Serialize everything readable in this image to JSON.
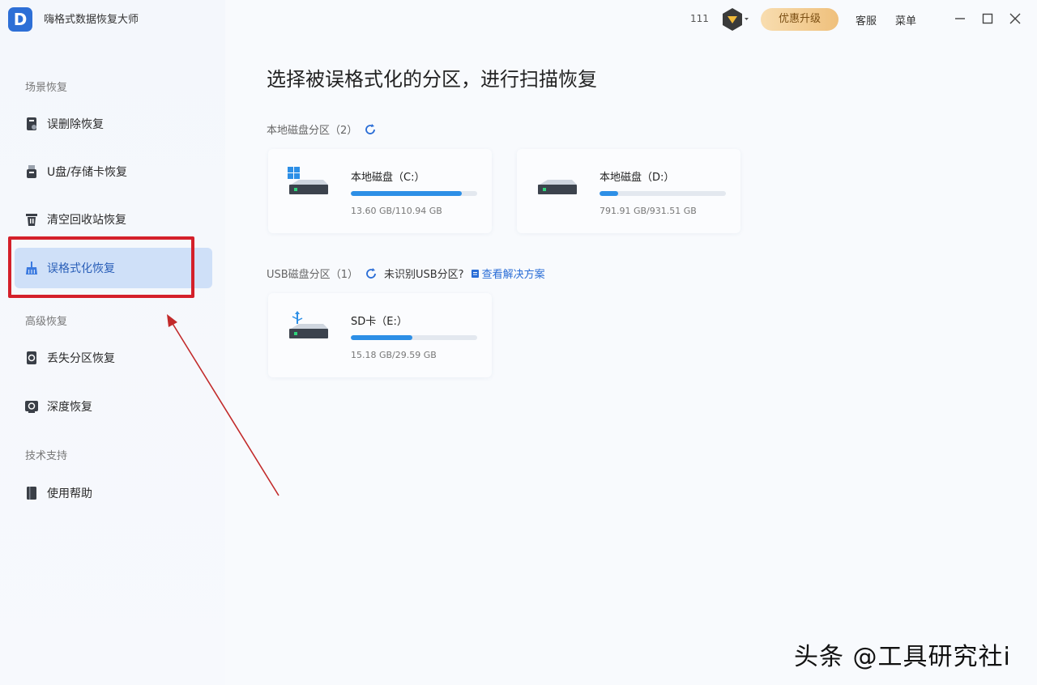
{
  "app": {
    "title": "嗨格式数据恢复大师",
    "logo_letter": "D"
  },
  "titlebar": {
    "user_id": "111",
    "upgrade_label": "优惠升级",
    "service_label": "客服",
    "menu_label": "菜单"
  },
  "sidebar": {
    "section1": "场景恢复",
    "section2": "高级恢复",
    "section3": "技术支持",
    "items": [
      {
        "label": "误删除恢复"
      },
      {
        "label": "U盘/存储卡恢复"
      },
      {
        "label": "清空回收站恢复"
      },
      {
        "label": "误格式化恢复"
      },
      {
        "label": "丢失分区恢复"
      },
      {
        "label": "深度恢复"
      },
      {
        "label": "使用帮助"
      }
    ]
  },
  "main": {
    "title": "选择被误格式化的分区，进行扫描恢复",
    "local_group": {
      "label": "本地磁盘分区",
      "count": "（2）"
    },
    "usb_group": {
      "label": "USB磁盘分区",
      "count": "（1）",
      "hint": "未识别USB分区?",
      "link": "查看解决方案"
    },
    "disks": [
      {
        "name": "本地磁盘（C:）",
        "size": "13.60 GB/110.94 GB",
        "fill_fraction": 0.877
      },
      {
        "name": "本地磁盘（D:）",
        "size": "791.91 GB/931.51 GB",
        "fill_fraction": 0.15
      },
      {
        "name": "SD卡（E:）",
        "size": "15.18 GB/29.59 GB",
        "fill_fraction": 0.487
      }
    ]
  },
  "watermark": "头条 @工具研究社i",
  "colors": {
    "accent": "#2d8fe6",
    "highlight_box": "#d4202a",
    "active_bg": "#cfe0f8"
  }
}
